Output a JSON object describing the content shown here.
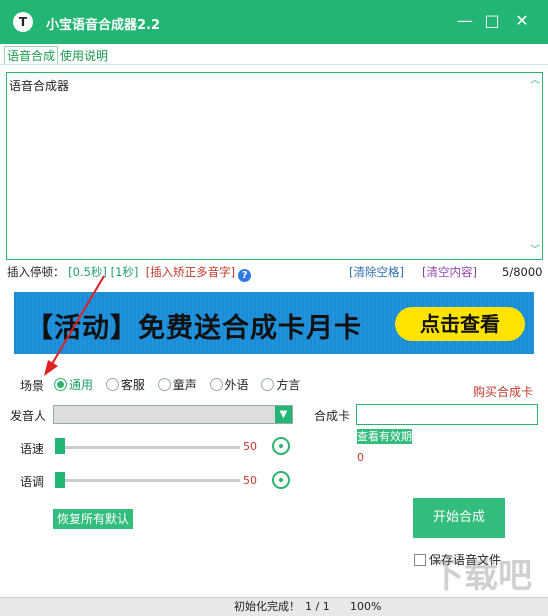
{
  "window": {
    "title": "小宝语音合成器2.2",
    "app_icon": "T",
    "minimize_glyph": "—",
    "maximize_glyph": "□",
    "close_glyph": "✕",
    "accent_color": "#22b573"
  },
  "tabs": [
    {
      "label": "语音合成",
      "active": true
    },
    {
      "label": "使用说明",
      "active": false
    }
  ],
  "editor": {
    "value": "语音合成器"
  },
  "pause_row": {
    "label": "插入停顿：",
    "pause_05": "[0.5秒]",
    "pause_1": "[1秒]",
    "polyphone": "[插入矫正多音字]",
    "help_glyph": "?",
    "clear_spaces": "[清除空格]",
    "clear_content": "[清空内容]",
    "char_count": "5/8000"
  },
  "banner": {
    "text": "【活动】免费送合成卡月卡",
    "button": "点击查看"
  },
  "scene": {
    "label": "场景",
    "options": [
      {
        "label": "通用",
        "selected": true
      },
      {
        "label": "客服",
        "selected": false
      },
      {
        "label": "童声",
        "selected": false
      },
      {
        "label": "外语",
        "selected": false
      },
      {
        "label": "方言",
        "selected": false
      }
    ]
  },
  "buy_card": "购买合成卡",
  "speaker": {
    "label": "发音人",
    "value": ""
  },
  "card": {
    "label": "合成卡",
    "value": "",
    "check_validity": "查看有效期",
    "balance": "0"
  },
  "speed": {
    "label": "语速",
    "value": "50"
  },
  "tone": {
    "label": "语调",
    "value": "50"
  },
  "restore_defaults": "恢复所有默认",
  "start_synthesis": "开始合成",
  "save_audio": {
    "label": "保存语音文件",
    "checked": false
  },
  "status": {
    "message": "初始化完成！",
    "progress": "1 / 1",
    "percent": "100%"
  },
  "watermark": "下载吧"
}
